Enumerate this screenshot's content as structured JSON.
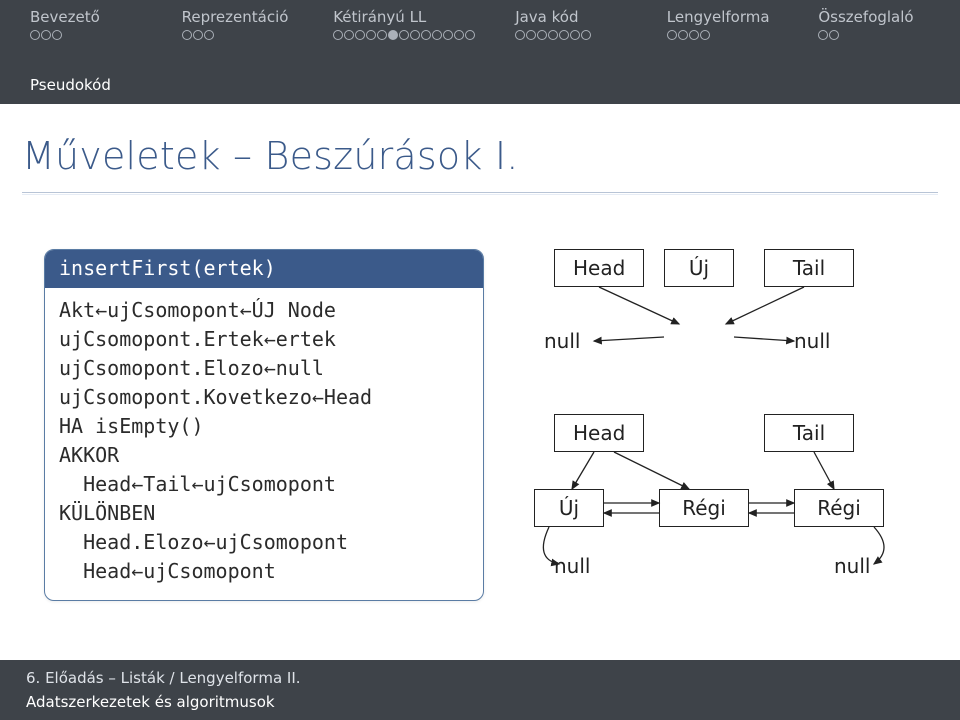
{
  "nav": [
    {
      "label": "Bevezető",
      "dots": 3,
      "filled": []
    },
    {
      "label": "Reprezentáció",
      "dots": 3,
      "filled": []
    },
    {
      "label": "Kétirányú LL",
      "dots": 13,
      "filled": [
        5
      ]
    },
    {
      "label": "Java kód",
      "dots": 7,
      "filled": []
    },
    {
      "label": "Lengyelforma",
      "dots": 4,
      "filled": []
    },
    {
      "label": "Összefoglaló",
      "dots": 2,
      "filled": []
    }
  ],
  "subheader": "Pseudokód",
  "title": "Műveletek – Beszúrások I.",
  "code": {
    "head": "insertFirst(ertek)",
    "lines": [
      "Akt←ujCsomopont←ÚJ Node",
      "ujCsomopont.Ertek←ertek",
      "ujCsomopont.Elozo←null",
      "ujCsomopont.Kovetkezo←Head",
      "HA isEmpty()",
      "AKKOR",
      "  Head←Tail←ujCsomopont",
      "KÜLÖNBEN",
      "  Head.Elozo←ujCsomopont",
      "  Head←ujCsomopont"
    ]
  },
  "diagram": {
    "top": {
      "head": "Head",
      "tail": "Tail",
      "null_left": "null",
      "uj": "Új",
      "null_right": "null"
    },
    "bot": {
      "head": "Head",
      "tail": "Tail",
      "uj": "Új",
      "regi1": "Régi",
      "regi2": "Régi",
      "null_left": "null",
      "null_right": "null"
    }
  },
  "footer": {
    "line1": "6. Előadás – Listák / Lengyelforma II.",
    "line2": "Adatszerkezetek és algoritmusok"
  }
}
